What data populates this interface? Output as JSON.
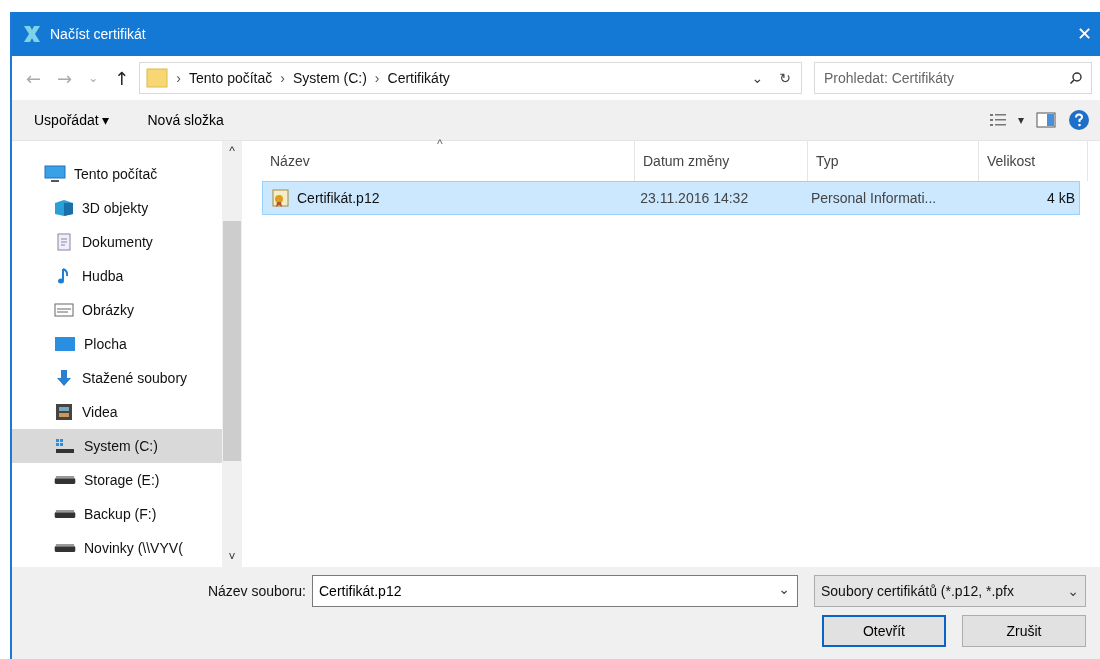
{
  "window": {
    "title": "Načíst certifikát",
    "close": "✕"
  },
  "nav": {
    "back": "←",
    "forward": "→",
    "recent": "⌄",
    "up": "↑",
    "breadcrumb": [
      "Tento počítač",
      "System (C:)",
      "Certifikáty"
    ],
    "separator": "›",
    "dropdown": "⌄",
    "refresh": "↻",
    "search_placeholder": "Prohledat: Certifikáty"
  },
  "toolbar": {
    "organize": "Uspořádat ▾",
    "new_folder": "Nová složka",
    "view_caret": "▾"
  },
  "sidebar": {
    "items": [
      {
        "label": "Tento počítač",
        "kind": "pc",
        "selected": false,
        "children": [
          {
            "label": "3D objekty",
            "kind": "cube",
            "selected": false
          },
          {
            "label": "Dokumenty",
            "kind": "doc",
            "selected": false
          },
          {
            "label": "Hudba",
            "kind": "music",
            "selected": false
          },
          {
            "label": "Obrázky",
            "kind": "picture",
            "selected": false
          },
          {
            "label": "Plocha",
            "kind": "desktop",
            "selected": false
          },
          {
            "label": "Stažené soubory",
            "kind": "download",
            "selected": false
          },
          {
            "label": "Videa",
            "kind": "video",
            "selected": false
          },
          {
            "label": "System (C:)",
            "kind": "sysdrive",
            "selected": true
          },
          {
            "label": "Storage (E:)",
            "kind": "drive",
            "selected": false
          },
          {
            "label": "Backup (F:)",
            "kind": "drive",
            "selected": false
          },
          {
            "label": "Novinky (\\\\VYV(",
            "kind": "drive",
            "selected": false
          }
        ]
      }
    ],
    "scroll_up": "^",
    "scroll_down": "˅"
  },
  "table": {
    "sort_mark": "^",
    "columns": [
      "Název",
      "Datum změny",
      "Typ",
      "Velikost"
    ],
    "rows": [
      {
        "name": "Certifikát.p12",
        "date": "23.11.2016 14:32",
        "type": "Personal Informati...",
        "size": "4 kB",
        "selected": true
      }
    ]
  },
  "footer": {
    "filename_label": "Název souboru:",
    "filename_value": "Certifikát.p12",
    "filename_caret": "⌄",
    "filter": "Soubory certifikátů (*.p12, *.pfx",
    "filter_caret": "⌄",
    "buttons": [
      "Otevřít",
      "Zrušit"
    ]
  }
}
